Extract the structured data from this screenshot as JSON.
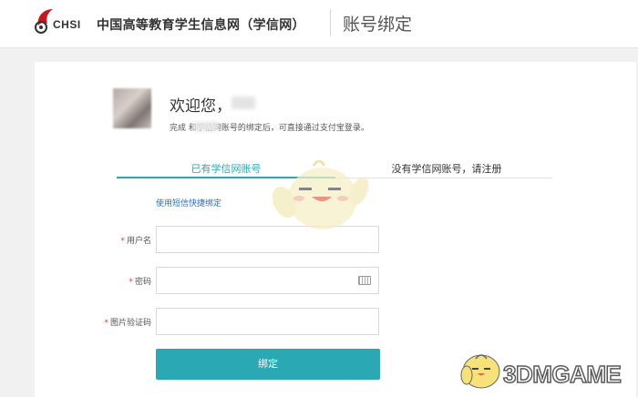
{
  "header": {
    "logo_text": "CHSI",
    "site_name": "中国高等教育学生信息网（学信网）",
    "page_title": "账号绑定"
  },
  "welcome": {
    "greeting": "欢迎您，",
    "desc": "完成        和学信网账号的绑定后，可直接通过支付宝登录。"
  },
  "tabs": [
    {
      "label": "已有学信网账号",
      "active": true
    },
    {
      "label": "没有学信网账号，请注册",
      "active": false
    }
  ],
  "sms_link": "使用短信快捷绑定",
  "form": {
    "required_mark": "*",
    "username_label": "用户名",
    "password_label": "密码",
    "captcha_label": "图片验证码",
    "submit_label": "绑定"
  },
  "watermark": {
    "text": "3DMGAME"
  },
  "colors": {
    "accent": "#2aa8b3",
    "link": "#2a6ec0",
    "required": "#e03a3a"
  }
}
